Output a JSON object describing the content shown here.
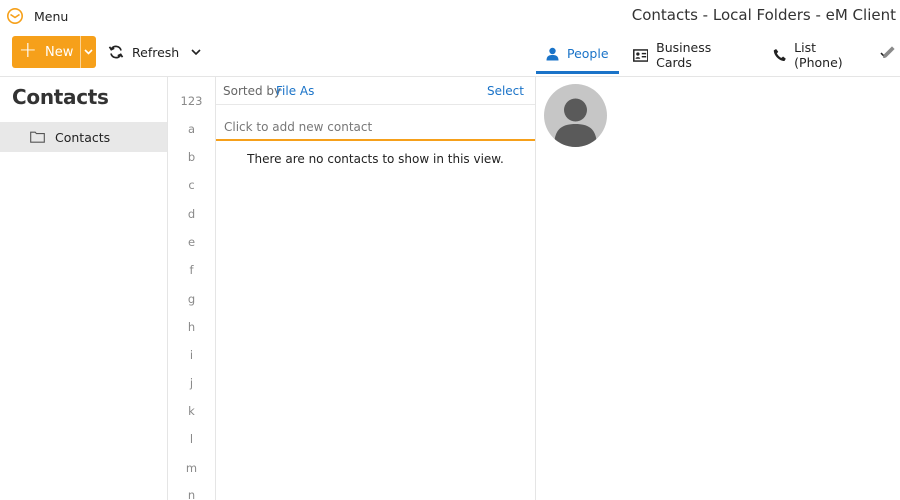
{
  "app": {
    "menu_label": "Menu",
    "window_title": "Contacts - Local Folders - eM Client",
    "logo_icon": "em-client-logo-icon",
    "accent_color": "#f6a01a",
    "link_color": "#1a73c8"
  },
  "toolbar": {
    "new_label": "New",
    "refresh_label": "Refresh",
    "views": [
      {
        "label": "People",
        "icon": "person-icon",
        "active": true
      },
      {
        "label": "Business Cards",
        "icon": "business-card-icon",
        "active": false
      },
      {
        "label": "List (Phone)",
        "icon": "phone-icon",
        "active": false
      }
    ]
  },
  "folders": {
    "title": "Contacts",
    "items": [
      {
        "label": "Contacts",
        "icon": "folder-icon",
        "selected": true
      }
    ]
  },
  "alphabet": [
    "123",
    "a",
    "b",
    "c",
    "d",
    "e",
    "f",
    "g",
    "h",
    "i",
    "j",
    "k",
    "l",
    "m",
    "n"
  ],
  "list": {
    "sort_prefix": "Sorted by",
    "sort_field": "File As",
    "select_label": "Select",
    "add_placeholder": "Click to add new contact",
    "empty_message": "There are no contacts to show in this view."
  },
  "detail": {
    "avatar_icon": "default-avatar-icon"
  }
}
